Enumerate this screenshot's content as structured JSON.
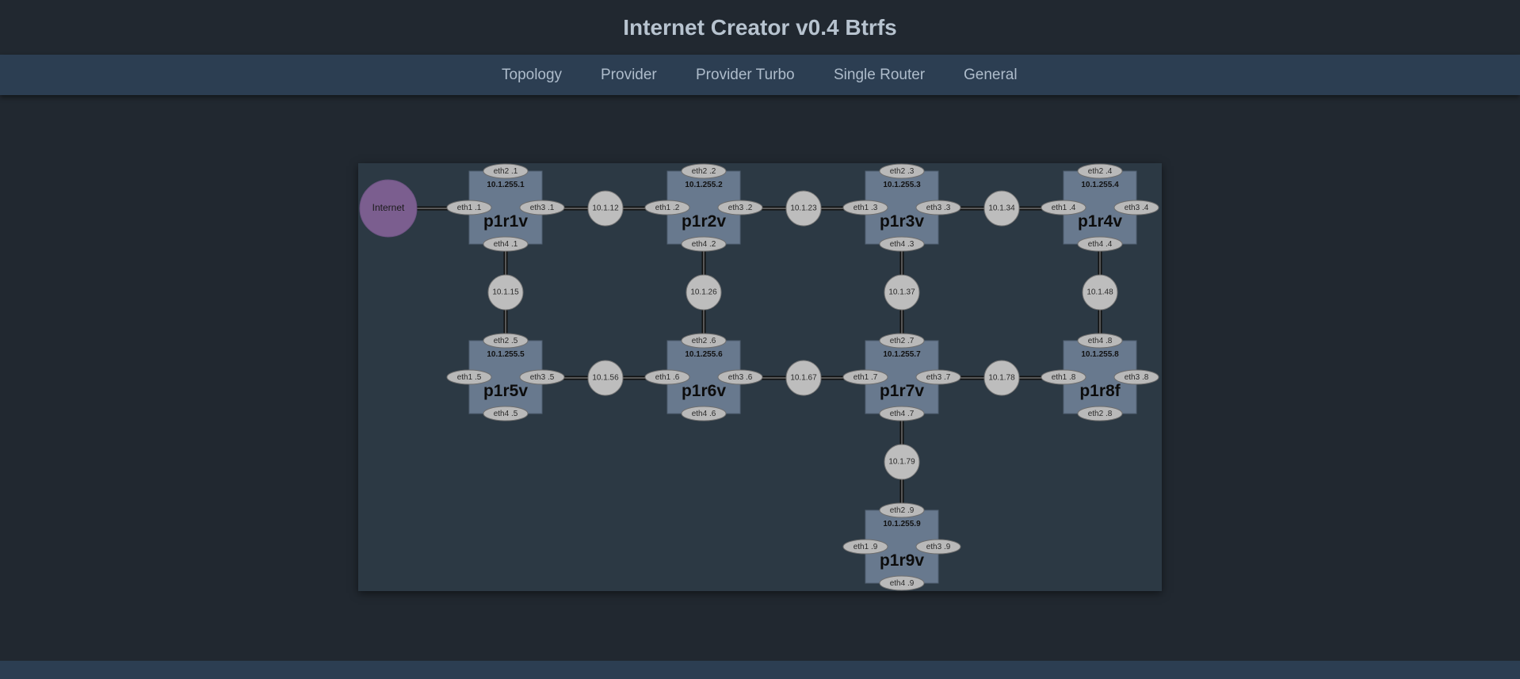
{
  "app": {
    "title": "Internet Creator v0.4 Btrfs"
  },
  "nav": [
    {
      "id": "topology",
      "label": "Topology"
    },
    {
      "id": "provider",
      "label": "Provider"
    },
    {
      "id": "provider-turbo",
      "label": "Provider Turbo"
    },
    {
      "id": "single-router",
      "label": "Single Router"
    },
    {
      "id": "general",
      "label": "General"
    }
  ],
  "topology": {
    "internet_label": "Internet",
    "routers": [
      {
        "name": "p1r1v",
        "loopback": "10.1.255.1",
        "ifaces": {
          "eth1": "eth1 .1",
          "eth2": "eth2 .1",
          "eth3": "eth3 .1",
          "eth4": "eth4 .1"
        }
      },
      {
        "name": "p1r2v",
        "loopback": "10.1.255.2",
        "ifaces": {
          "eth1": "eth1 .2",
          "eth2": "eth2 .2",
          "eth3": "eth3 .2",
          "eth4": "eth4 .2"
        }
      },
      {
        "name": "p1r3v",
        "loopback": "10.1.255.3",
        "ifaces": {
          "eth1": "eth1 .3",
          "eth2": "eth2 .3",
          "eth3": "eth3 .3",
          "eth4": "eth4 .3"
        }
      },
      {
        "name": "p1r4v",
        "loopback": "10.1.255.4",
        "ifaces": {
          "eth1": "eth1 .4",
          "eth2": "eth2 .4",
          "eth3": "eth3 .4",
          "eth4": "eth4 .4"
        }
      },
      {
        "name": "p1r5v",
        "loopback": "10.1.255.5",
        "ifaces": {
          "eth1": "eth1 .5",
          "eth2": "eth2 .5",
          "eth3": "eth3 .5",
          "eth4": "eth4 .5"
        }
      },
      {
        "name": "p1r6v",
        "loopback": "10.1.255.6",
        "ifaces": {
          "eth1": "eth1 .6",
          "eth2": "eth2 .6",
          "eth3": "eth3 .6",
          "eth4": "eth4 .6"
        }
      },
      {
        "name": "p1r7v",
        "loopback": "10.1.255.7",
        "ifaces": {
          "eth1": "eth1 .7",
          "eth2": "eth2 .7",
          "eth3": "eth3 .7",
          "eth4": "eth4 .7"
        }
      },
      {
        "name": "p1r8f",
        "loopback": "10.1.255.8",
        "ifaces": {
          "eth1": "eth1 .8",
          "eth2": "eth4 .8",
          "eth3": "eth3 .8",
          "eth4": "eth2 .8"
        }
      },
      {
        "name": "p1r9v",
        "loopback": "10.1.255.9",
        "ifaces": {
          "eth1": "eth1 .9",
          "eth2": "eth2 .9",
          "eth3": "eth3 .9",
          "eth4": "eth4 .9"
        }
      }
    ],
    "networks": [
      "10.1.12",
      "10.1.23",
      "10.1.34",
      "10.1.15",
      "10.1.26",
      "10.1.37",
      "10.1.48",
      "10.1.56",
      "10.1.67",
      "10.1.78",
      "10.1.79"
    ]
  }
}
